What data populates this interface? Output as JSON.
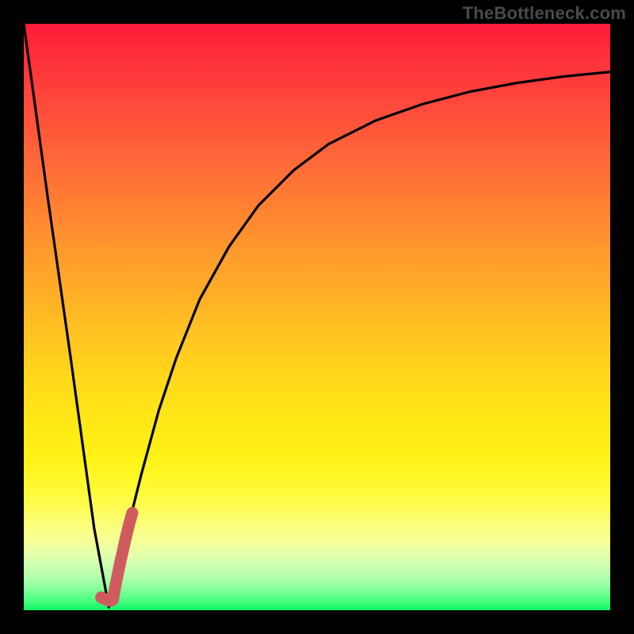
{
  "watermark": "TheBottleneck.com",
  "colors": {
    "frame_bg": "#000000",
    "curve_stroke": "#000000",
    "marker_stroke": "#cf5b5f",
    "gradient_top": "#ff1a3a",
    "gradient_bottom": "#10f564"
  },
  "chart_data": {
    "type": "line",
    "title": "",
    "xlabel": "",
    "ylabel": "",
    "xlim": [
      0,
      100
    ],
    "ylim": [
      0,
      100
    ],
    "grid": false,
    "legend": false,
    "series": [
      {
        "name": "bottleneck-curve",
        "x": [
          0,
          4,
          8,
          12,
          14.5,
          16,
          18,
          20,
          23,
          26,
          30,
          35,
          40,
          46,
          52,
          60,
          68,
          76,
          84,
          92,
          100
        ],
        "y": [
          100,
          71,
          43,
          14,
          0.5,
          6,
          15,
          23,
          34,
          43,
          53,
          62,
          69,
          75,
          79.5,
          83.5,
          86.3,
          88.4,
          89.9,
          91,
          91.8
        ]
      },
      {
        "name": "optimal-marker",
        "x": [
          13.2,
          13.6,
          14.0,
          14.4,
          14.8,
          15.2,
          15.5,
          16.0,
          16.5,
          17.0,
          17.5,
          18.0,
          18.5
        ],
        "y": [
          2.2,
          2.0,
          1.8,
          1.7,
          1.6,
          1.8,
          3.5,
          6.0,
          8.4,
          10.6,
          12.8,
          14.8,
          16.6
        ]
      }
    ]
  }
}
